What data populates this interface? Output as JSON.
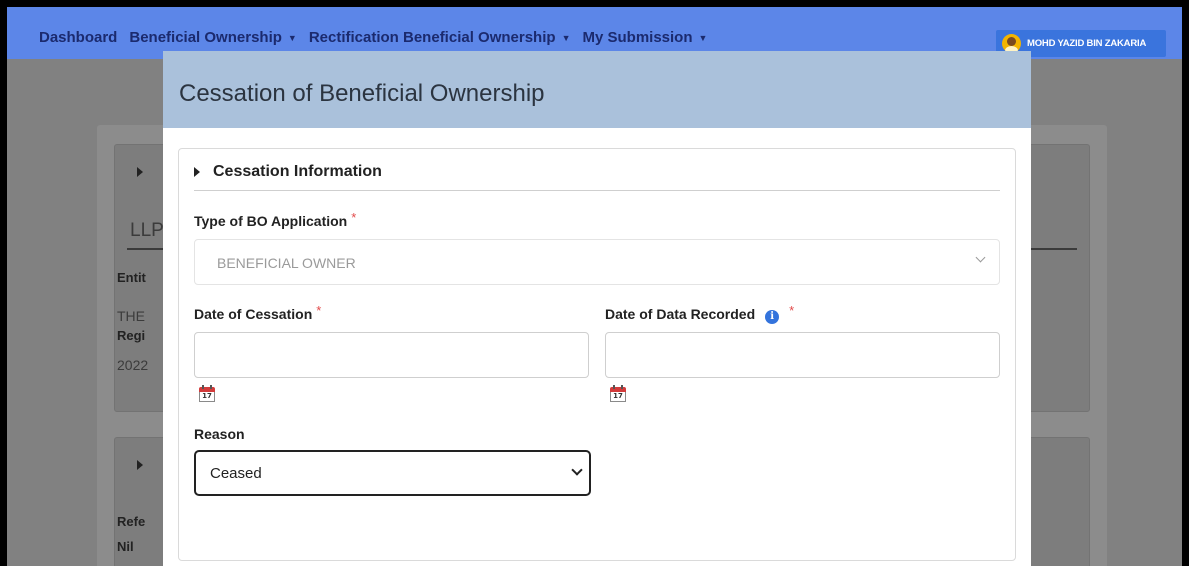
{
  "navbar": {
    "items": [
      {
        "label": "Dashboard",
        "dropdown": false
      },
      {
        "label": "Beneficial Ownership",
        "dropdown": true
      },
      {
        "label": "Rectification Beneficial Ownership",
        "dropdown": true
      },
      {
        "label": "My Submission",
        "dropdown": true
      }
    ],
    "user_name": "MOHD YAZID BIN ZAKARIA"
  },
  "background": {
    "card1": {
      "heading": "LLP",
      "field1_label": "Entit",
      "field1_value": "THE",
      "field2_label": "Regi",
      "field2_value": "2022"
    },
    "card2": {
      "field_label": "Refe",
      "field_value": "Nil"
    }
  },
  "modal": {
    "title": "Cessation of Beneficial Ownership",
    "section_title": "Cessation Information",
    "type_label": "Type of BO Application",
    "type_value": "BENEFICIAL OWNER",
    "date_cessation_label": "Date of Cessation",
    "date_recorded_label": "Date of Data Recorded",
    "date_cessation_value": "",
    "date_recorded_value": "",
    "calendar_day": "17",
    "reason_label": "Reason",
    "reason_value": "Ceased",
    "required_mark": "*"
  },
  "colors": {
    "navbar": "#5c86e8",
    "modal_header": "#aac1db",
    "required": "#e24a4a",
    "info": "#3373dc"
  }
}
